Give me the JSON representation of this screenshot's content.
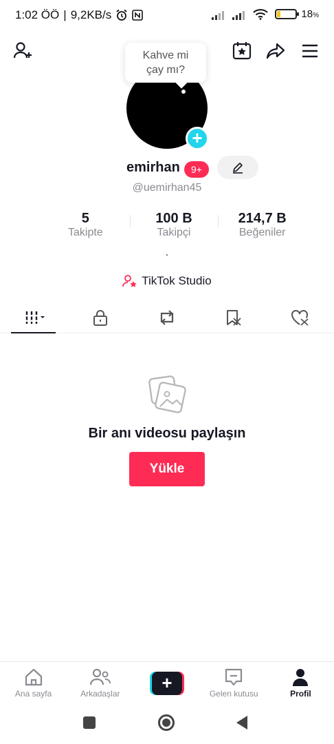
{
  "status_bar": {
    "time": "1:02 ÖÖ",
    "net_speed": "9,2KB/s",
    "battery_percent": "18",
    "battery_suffix": "%",
    "battery_level": 0.18,
    "battery_color": "#f5c518"
  },
  "top_nav": {
    "icons": [
      "add-friend-icon",
      "calendar-star-icon",
      "share-icon",
      "menu-icon"
    ]
  },
  "bubble": {
    "line1": "Kahve mi",
    "line2": "çay mı?"
  },
  "profile": {
    "username": "emirhan",
    "badge": "9+",
    "handle": "@uemirhan45",
    "bio": "."
  },
  "stats": [
    {
      "value": "5",
      "label": "Takipte"
    },
    {
      "value": "100 B",
      "label": "Takipçi"
    },
    {
      "value": "214,7 B",
      "label": "Beğeniler"
    }
  ],
  "studio": {
    "label": "TikTok Studio"
  },
  "tabs": [
    "videos-grid-icon",
    "lock-icon",
    "repost-icon",
    "favorites-icon",
    "liked-icon"
  ],
  "empty_state": {
    "title": "Bir anı videosu paylaşın",
    "button": "Yükle"
  },
  "bottom_nav": [
    {
      "label": "Ana sayfa",
      "icon": "home-icon"
    },
    {
      "label": "Arkadaşlar",
      "icon": "friends-icon"
    },
    {
      "label": "",
      "icon": "create-icon"
    },
    {
      "label": "Gelen kutusu",
      "icon": "inbox-icon"
    },
    {
      "label": "Profil",
      "icon": "profile-icon"
    }
  ],
  "colors": {
    "accent": "#fe2c55",
    "cyan": "#20d5ec",
    "text": "#161823",
    "muted": "#8a8b91"
  }
}
